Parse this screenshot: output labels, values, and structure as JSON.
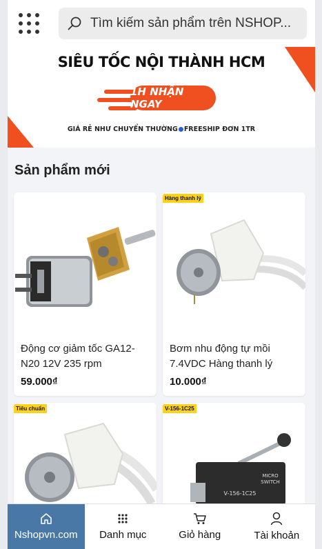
{
  "search": {
    "placeholder": "Tìm kiếm sản phẩm trên NSHOP..."
  },
  "banner": {
    "title": "SIÊU TỐC NỘI THÀNH HCM",
    "pill": "1H NHẬN NGAY",
    "subtitle_left": "GIÁ RẺ NHƯ CHUYỂN THƯỜNG",
    "subtitle_right": "FREESHIP ĐƠN 1TR"
  },
  "section": {
    "title": "Sản phẩm mới"
  },
  "products": [
    {
      "name": "Động cơ giảm tốc GA12-N20 12V 235 rpm",
      "price": "59.000₫",
      "tag": ""
    },
    {
      "name": "Bơm nhu động tự mồi 7.4VDC Hàng thanh lý",
      "price": "10.000₫",
      "tag": "Hàng thanh lý"
    },
    {
      "name": "",
      "price": "",
      "tag": "Tiêu chuẩn"
    },
    {
      "name": "",
      "price": "",
      "tag": "V-156-1C25",
      "switch_text": "V-156-1C25"
    }
  ],
  "nav": [
    {
      "label": "Nshopvn.com",
      "icon": "home-icon",
      "active": true
    },
    {
      "label": "Danh mục",
      "icon": "grid-icon",
      "active": false
    },
    {
      "label": "Giỏ hàng",
      "icon": "cart-icon",
      "active": false
    },
    {
      "label": "Tài khoản",
      "icon": "user-icon",
      "active": false
    }
  ],
  "colors": {
    "accent": "#f0501f",
    "nav_active": "#4a78a6",
    "tag": "#ffd21a"
  }
}
